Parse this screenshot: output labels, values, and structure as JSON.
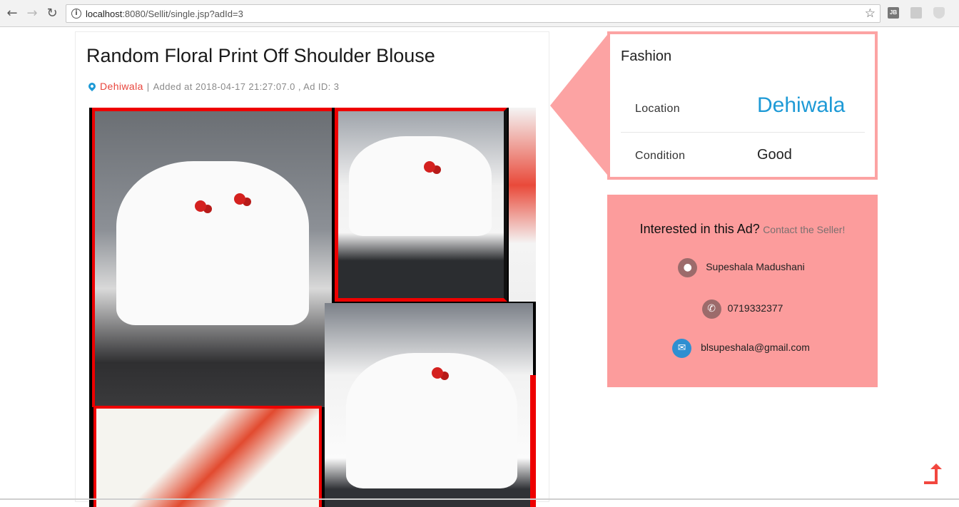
{
  "browser": {
    "url_host": "localhost",
    "url_rest": ":8080/Sellit/single.jsp?adId=3",
    "ext_jb": "JB"
  },
  "ad": {
    "title": "Random Floral Print Off Shoulder Blouse",
    "location": "Dehiwala",
    "separator": "|",
    "added_label": "Added at",
    "added_at": "2018-04-17 21:27:07.0",
    "comma": ",",
    "id_label": "Ad ID:",
    "ad_id": "3"
  },
  "details": {
    "category": "Fashion",
    "location_label": "Location",
    "location_value": "Dehiwala",
    "condition_label": "Condition",
    "condition_value": "Good"
  },
  "contact": {
    "question": "Interested in this Ad?",
    "cta": "Contact the Seller!",
    "name": "Supeshala Madushani",
    "phone": "0719332377",
    "email": "blsupeshala@gmail.com"
  },
  "colors": {
    "accent_pink": "#fc9c9c",
    "border_pink": "#fca3a3",
    "link_blue": "#1e9ad6",
    "location_red": "#e8453c",
    "scroll_red": "#f2473f"
  },
  "icons": [
    "back-icon",
    "forward-icon",
    "reload-icon",
    "info-icon",
    "star-icon",
    "pin-icon",
    "user-icon",
    "phone-icon",
    "mail-icon",
    "scroll-top-icon"
  ]
}
